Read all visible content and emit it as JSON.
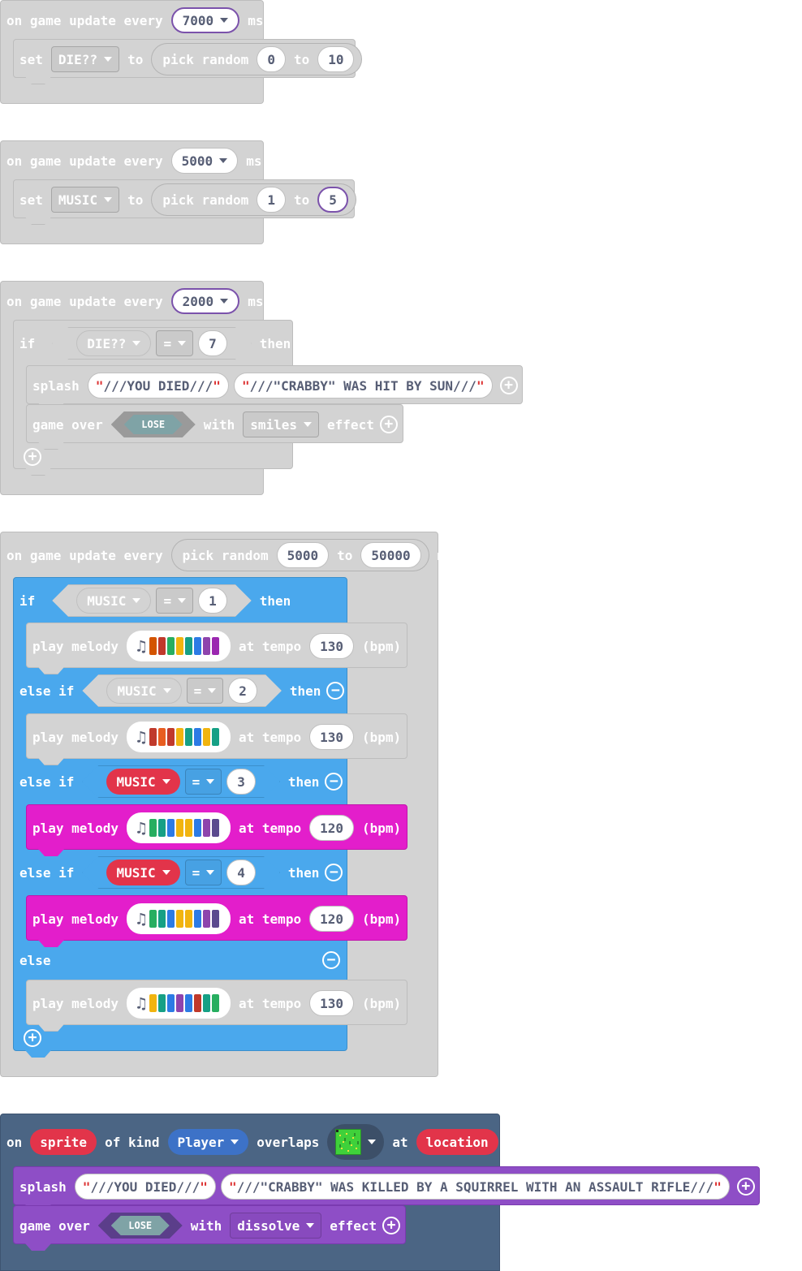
{
  "colors": {
    "gray": "#d3d3d3",
    "blue": "#4aa8ed",
    "pink": "#e31ecb",
    "slate": "#4b6584",
    "purple": "#8e4ec6",
    "red_variable": "#e2344a",
    "dark_blue_kind": "#3d72c7"
  },
  "kw": {
    "on_game_update_every": "on game update every",
    "ms": "ms",
    "set": "set",
    "to": "to",
    "pick_random": "pick random",
    "if": "if",
    "then": "then",
    "else_if": "else if",
    "else": "else",
    "splash": "splash",
    "game_over": "game over",
    "with": "with",
    "effect": "effect",
    "play_melody": "play melody",
    "at_tempo": "at tempo",
    "bpm": "(bpm)",
    "eq": "=",
    "on": "on",
    "of_kind": "of kind",
    "overlaps": "overlaps",
    "at": "at",
    "lose": "LOSE"
  },
  "block1": {
    "interval": "7000",
    "variable": "DIE??",
    "min": "0",
    "max": "10"
  },
  "block2": {
    "interval": "5000",
    "variable": "MUSIC",
    "min": "1",
    "max": "5"
  },
  "block3": {
    "interval": "2000",
    "cond_var": "DIE??",
    "cond_value": "7",
    "splash_title": "///YOU DIED///",
    "splash_sub": "///\"CRABBY\" WAS HIT BY SUN///",
    "effect": "smiles"
  },
  "block4": {
    "min": "5000",
    "max": "50000",
    "cond_var": "MUSIC",
    "branches": [
      {
        "value": "1",
        "tempo": "130",
        "colors": [
          "#d35400",
          "#c0392b",
          "#27ae60",
          "#f1b40f",
          "#16a085",
          "#2c7be5",
          "#8e44ad",
          "#9b27b0"
        ]
      },
      {
        "value": "2",
        "tempo": "130",
        "colors": [
          "#c0392b",
          "#e85d20",
          "#c0392b",
          "#f1b40f",
          "#16a085",
          "#2c7be5",
          "#f1b40f",
          "#16a085"
        ]
      },
      {
        "value": "3",
        "tempo": "120",
        "colors": [
          "#27ae60",
          "#16a085",
          "#2c7be5",
          "#f1b40f",
          "#f1b40f",
          "#2c7be5",
          "#8e44ad",
          "#5b4a8e"
        ]
      },
      {
        "value": "4",
        "tempo": "120",
        "colors": [
          "#27ae60",
          "#16a085",
          "#2c7be5",
          "#f1b40f",
          "#f1b40f",
          "#2c7be5",
          "#8e44ad",
          "#5b4a8e"
        ]
      },
      {
        "value": "",
        "tempo": "130",
        "colors": [
          "#f1b40f",
          "#16a085",
          "#2c7be5",
          "#8e44ad",
          "#2c7be5",
          "#c0392b",
          "#16a085",
          "#27ae60"
        ]
      }
    ]
  },
  "block5": {
    "sprite": "sprite",
    "kind": "Player",
    "location": "location",
    "splash_title": "///YOU DIED///",
    "splash_sub": "///\"CRABBY\" WAS KILLED BY A SQUIRREL WITH AN ASSAULT RIFLE///",
    "effect": "dissolve"
  }
}
